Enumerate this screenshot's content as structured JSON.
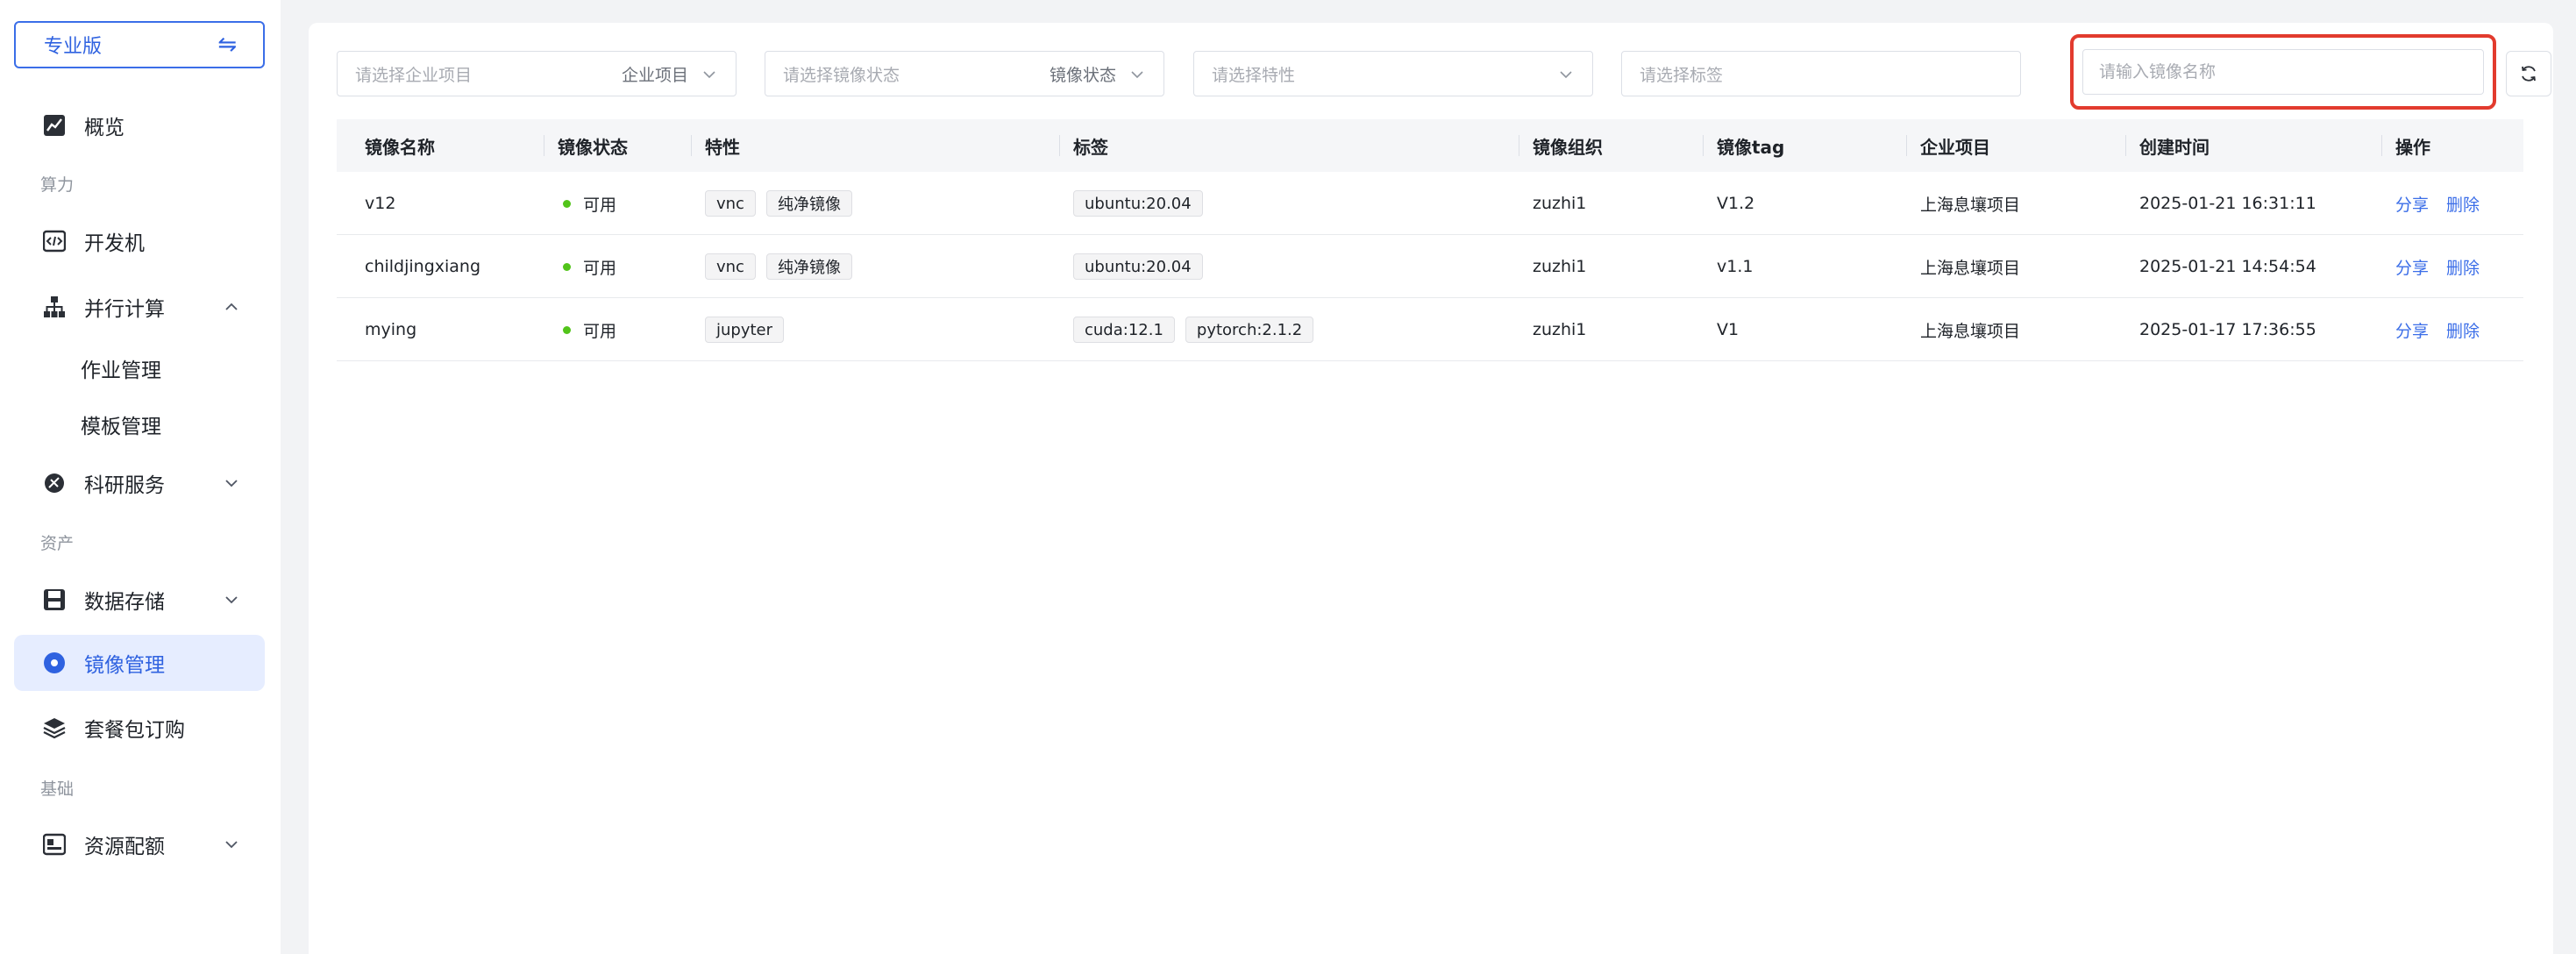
{
  "sidebar": {
    "edition_label": "专业版",
    "swap_icon": "⇋",
    "items": {
      "overview": "概览",
      "devmachine": "开发机",
      "parallel": "并行计算",
      "job_mgmt": "作业管理",
      "template_mgmt": "模板管理",
      "research": "科研服务",
      "storage": "数据存储",
      "image_mgmt": "镜像管理",
      "package": "套餐包订购",
      "quota": "资源配额"
    },
    "groups": {
      "compute": "算力",
      "assets": "资产",
      "basic": "基础"
    }
  },
  "filters": {
    "project_placeholder": "请选择企业项目",
    "project_tag": "企业项目",
    "status_placeholder": "请选择镜像状态",
    "status_tag": "镜像状态",
    "feature_placeholder": "请选择特性",
    "label_placeholder": "请选择标签",
    "name_placeholder": "请输入镜像名称"
  },
  "table": {
    "headers": [
      "镜像名称",
      "镜像状态",
      "特性",
      "标签",
      "镜像组织",
      "镜像tag",
      "企业项目",
      "创建时间",
      "操作"
    ],
    "rows": [
      {
        "name": "v12",
        "status": "可用",
        "features": [
          "vnc",
          "纯净镜像"
        ],
        "labels": [
          "ubuntu:20.04"
        ],
        "org": "zuzhi1",
        "tag": "V1.2",
        "project": "上海息壤项目",
        "created": "2025-01-21 16:31:11",
        "share": "分享",
        "delete": "删除"
      },
      {
        "name": "childjingxiang",
        "status": "可用",
        "features": [
          "vnc",
          "纯净镜像"
        ],
        "labels": [
          "ubuntu:20.04"
        ],
        "org": "zuzhi1",
        "tag": "v1.1",
        "project": "上海息壤项目",
        "created": "2025-01-21 14:54:54",
        "share": "分享",
        "delete": "删除"
      },
      {
        "name": "mying",
        "status": "可用",
        "features": [
          "jupyter"
        ],
        "labels": [
          "cuda:12.1",
          "pytorch:2.1.2"
        ],
        "org": "zuzhi1",
        "tag": "V1",
        "project": "上海息壤项目",
        "created": "2025-01-17 17:36:55",
        "share": "分享",
        "delete": "删除"
      }
    ]
  },
  "colors": {
    "accent": "#3b6ee8",
    "active_bg": "#e6edff",
    "status_ok": "#52c41a",
    "highlight": "#e23b2e"
  }
}
